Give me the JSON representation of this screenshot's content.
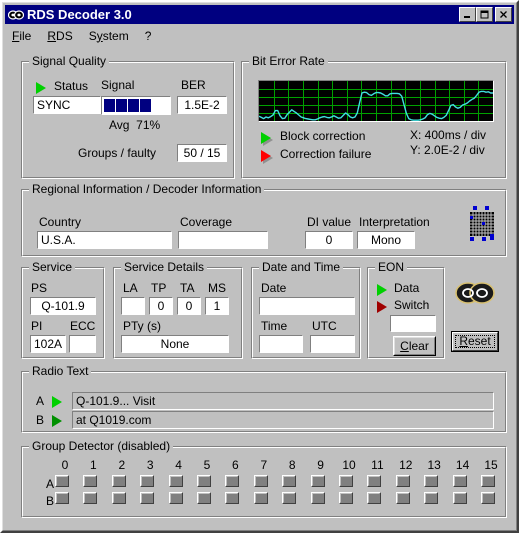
{
  "window": {
    "title": "RDS Decoder 3.0",
    "icon": "rds-rings-icon",
    "minimize_label": "minimize-icon",
    "maximize_label": "maximize-icon",
    "close_label": "close-icon"
  },
  "menu": {
    "items": [
      {
        "label": "File",
        "accel": "F"
      },
      {
        "label": "RDS",
        "accel": "R"
      },
      {
        "label": "System",
        "accel": "y"
      },
      {
        "label": "?",
        "accel": ""
      }
    ]
  },
  "signal_quality": {
    "legend": "Signal Quality",
    "status_label": "Status",
    "status_indicator": "green",
    "status_value": "SYNC",
    "signal_label": "Signal",
    "signal_blocks_filled": 4,
    "signal_blocks_total": 9,
    "avg_label": "Avg",
    "avg_value": "71%",
    "ber_label": "BER",
    "ber_value": "1.5E-2",
    "groups_label": "Groups / faulty",
    "groups_value": "50 / 15"
  },
  "bit_error_rate": {
    "legend": "Bit Error Rate",
    "block_correction_label": "Block correction",
    "block_correction_indicator": "green",
    "correction_failure_label": "Correction failure",
    "correction_failure_indicator": "red",
    "x_scale": "X: 400ms / div",
    "y_scale": "Y: 2.0E-2 / div"
  },
  "chart_data": {
    "type": "line",
    "title": "Bit Error Rate",
    "xlabel": "X: 400ms / div",
    "ylabel": "Y: 2.0E-2 / div",
    "grid": true,
    "grid_cols": 16,
    "grid_rows": 5,
    "line_color": "#40e0e0",
    "grid_color": "#00a000",
    "background": "#000000",
    "xlim": [
      0,
      100
    ],
    "ylim": [
      0,
      10
    ],
    "x": [
      0,
      1,
      2,
      3,
      4,
      5,
      6,
      7,
      8,
      9,
      10,
      11,
      12,
      13,
      14,
      15,
      16,
      17,
      18,
      19,
      20,
      21,
      22,
      23,
      24,
      25,
      26,
      27,
      28,
      29,
      30,
      31,
      32,
      33,
      34,
      35,
      36,
      37,
      38,
      39,
      40,
      41,
      42,
      43,
      44,
      45,
      46,
      47,
      48,
      49,
      50,
      51,
      52,
      53,
      54,
      55,
      56,
      57,
      58,
      59,
      60,
      61,
      62,
      63,
      64,
      65,
      66,
      67,
      68,
      69,
      70,
      71,
      72,
      73,
      74,
      75,
      76,
      77,
      78,
      79,
      80,
      81,
      82,
      83,
      84,
      85,
      86,
      87,
      88,
      89,
      90,
      91,
      92,
      93,
      94,
      95,
      96,
      97,
      98,
      99,
      100
    ],
    "values": [
      1.2,
      0.9,
      0.6,
      1.0,
      0.8,
      1.1,
      1.5,
      2.6,
      2.6,
      1.3,
      0.6,
      0.7,
      1.6,
      2.2,
      2.8,
      2.4,
      2.0,
      1.5,
      1.0,
      0.8,
      0.6,
      0.5,
      0.4,
      0.3,
      0.3,
      0.5,
      0.8,
      1.0,
      1.1,
      0.9,
      0.8,
      1.0,
      1.3,
      1.0,
      0.7,
      0.8,
      1.4,
      2.0,
      1.6,
      1.0,
      0.8,
      1.0,
      2.0,
      4.6,
      7.0,
      7.2,
      7.1,
      6.6,
      6.4,
      6.8,
      7.1,
      7.1,
      7.0,
      6.7,
      6.3,
      6.3,
      6.8,
      6.9,
      6.9,
      6.9,
      6.8,
      6.2,
      4.0,
      1.9,
      0.6,
      0.3,
      0.2,
      0.2,
      0.2,
      0.3,
      0.5,
      0.8,
      1.6,
      1.9,
      1.7,
      1.3,
      0.9,
      0.7,
      0.6,
      0.9,
      1.4,
      2.6,
      3.9,
      4.1,
      3.5,
      3.2,
      3.4,
      4.0,
      4.2,
      4.5,
      5.0,
      5.4,
      5.7,
      6.4,
      7.2,
      7.4,
      7.4,
      7.2,
      7.3,
      7.0,
      7.0
    ]
  },
  "regional": {
    "legend": "Regional Information / Decoder Information",
    "country_label": "Country",
    "country_value": "U.S.A.",
    "coverage_label": "Coverage",
    "coverage_value": "",
    "di_label": "DI value",
    "di_value": "0",
    "interpretation_label": "Interpretation",
    "interpretation_value": "Mono",
    "matrix_icon": "decoder-matrix-icon"
  },
  "service": {
    "legend": "Service",
    "ps_label": "PS",
    "ps_value": "Q-101.9",
    "pi_label": "PI",
    "pi_value": "102A",
    "ecc_label": "ECC",
    "ecc_value": ""
  },
  "service_details": {
    "legend": "Service Details",
    "la_label": "LA",
    "la_value": "",
    "tp_label": "TP",
    "tp_value": "0",
    "ta_label": "TA",
    "ta_value": "0",
    "ms_label": "MS",
    "ms_value": "1",
    "pty_label": "PTy (s)",
    "pty_value": "None"
  },
  "datetime": {
    "legend": "Date and Time",
    "date_label": "Date",
    "date_value": "",
    "time_label": "Time",
    "time_value": "",
    "utc_label": "UTC",
    "utc_value": ""
  },
  "eon": {
    "legend": "EON",
    "data_label": "Data",
    "data_indicator": "green",
    "switch_label": "Switch",
    "switch_indicator": "darkred",
    "field_value": "",
    "clear_label": "Clear",
    "clear_accel": "C"
  },
  "reset": {
    "label": "Reset",
    "accel": "R"
  },
  "brand": {
    "logo": "rds-rings-logo"
  },
  "radio_text": {
    "legend": "Radio Text",
    "rows": [
      {
        "name": "A",
        "indicator": "green",
        "text": "Q-101.9... Visit"
      },
      {
        "name": "B",
        "indicator": "green-dim",
        "text": "            at Q1019.com"
      }
    ]
  },
  "group_detector": {
    "legend": "Group Detector (disabled)",
    "columns": [
      "0",
      "1",
      "2",
      "3",
      "4",
      "5",
      "6",
      "7",
      "8",
      "9",
      "10",
      "11",
      "12",
      "13",
      "14",
      "15"
    ],
    "rows": [
      {
        "name": "A"
      },
      {
        "name": "B"
      }
    ]
  }
}
